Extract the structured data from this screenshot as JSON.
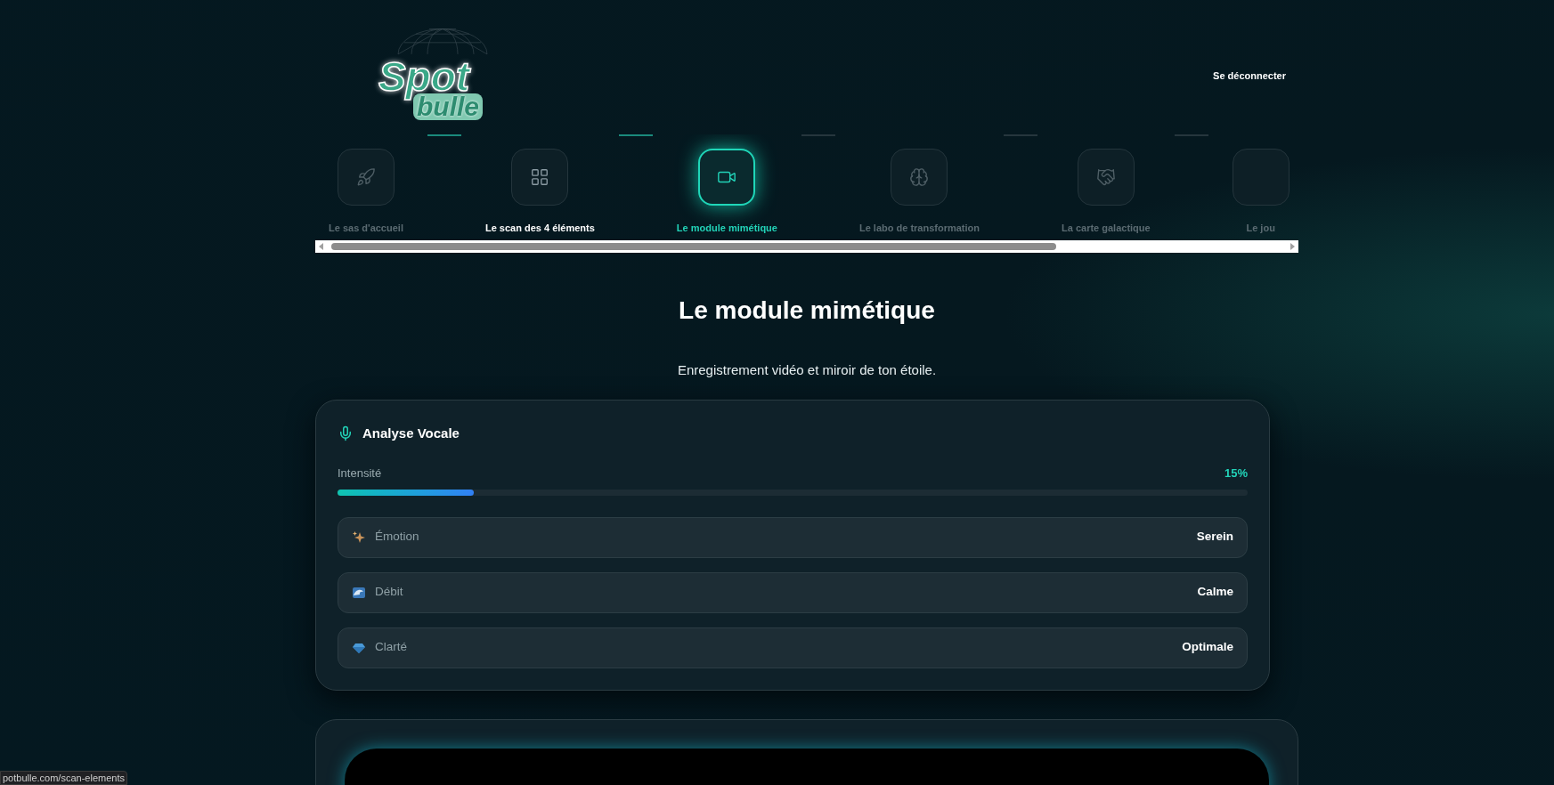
{
  "logo": {
    "line1": "Spot",
    "line2": "bulle"
  },
  "header": {
    "logout": "Se déconnecter"
  },
  "steps": [
    {
      "label": "Le sas d'accueil",
      "selected": false,
      "highlighted": false
    },
    {
      "label": "Le scan des 4 éléments",
      "selected": false,
      "highlighted": true
    },
    {
      "label": "Le module mimétique",
      "selected": true,
      "highlighted": false
    },
    {
      "label": "Le labo de transformation",
      "selected": false,
      "highlighted": false
    },
    {
      "label": "La carte galactique",
      "selected": false,
      "highlighted": false
    },
    {
      "label": "Le jou",
      "selected": false,
      "highlighted": false
    }
  ],
  "step_connectors": [
    {
      "completed": true
    },
    {
      "completed": true
    },
    {
      "completed": false
    },
    {
      "completed": false
    },
    {
      "completed": false
    }
  ],
  "page": {
    "title": "Le module mimétique",
    "subtitle": "Enregistrement vidéo et miroir de ton étoile."
  },
  "voice_card": {
    "title": "Analyse Vocale",
    "intensity": {
      "label": "Intensité",
      "reading": "15%",
      "level": 0.15
    },
    "metrics": [
      {
        "kind": "sparkles",
        "label": "Émotion",
        "value": "Serein"
      },
      {
        "kind": "wave",
        "label": "Débit",
        "value": "Calme"
      },
      {
        "kind": "gem",
        "label": "Clarté",
        "value": "Optimale"
      }
    ]
  },
  "status_bar": {
    "url": "potbulle.com/scan-elements"
  }
}
